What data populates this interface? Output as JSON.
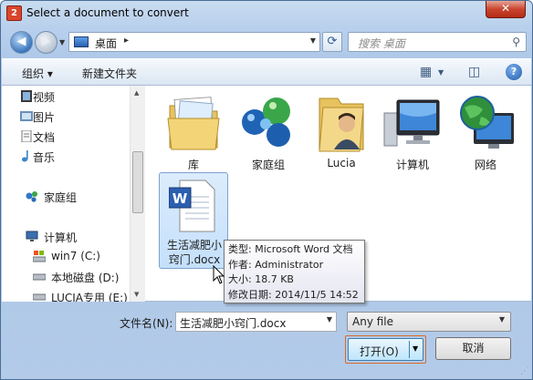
{
  "window": {
    "title": "Select a document to convert",
    "app_icon_text": "2",
    "close_glyph": "✕"
  },
  "nav": {
    "back_glyph": "◀",
    "forward_glyph": "▶"
  },
  "address": {
    "location": "桌面",
    "chevron": "▸"
  },
  "search": {
    "placeholder": "搜索 桌面"
  },
  "toolbar": {
    "organize": "组织 ▾",
    "new_folder": "新建文件夹",
    "help": "?"
  },
  "sidebar": {
    "items": [
      {
        "label": "视频"
      },
      {
        "label": "图片"
      },
      {
        "label": "文档"
      },
      {
        "label": "音乐"
      },
      {
        "label": "家庭组"
      },
      {
        "label": "计算机"
      },
      {
        "label": "win7 (C:)"
      },
      {
        "label": "本地磁盘 (D:)"
      },
      {
        "label": "LUCIA专用 (E:)"
      }
    ]
  },
  "files": [
    {
      "label": "库",
      "icon": "libraries-icon"
    },
    {
      "label": "家庭组",
      "icon": "homegroup-icon"
    },
    {
      "label": "Lucia",
      "icon": "user-folder-icon"
    },
    {
      "label": "计算机",
      "icon": "computer-icon"
    },
    {
      "label": "网络",
      "icon": "network-icon"
    },
    {
      "label_line1": "生活减肥小",
      "label_line2": "窍门.docx",
      "icon": "word-document-icon",
      "selected": true
    }
  ],
  "tooltip": {
    "type": "类型: Microsoft Word 文档",
    "author": "作者: Administrator",
    "size": "大小: 18.7 KB",
    "modified": "修改日期: 2014/11/5 14:52"
  },
  "footer": {
    "filename_label": "文件名(N):",
    "filename_value": "生活减肥小窍门.docx",
    "filter_value": "Any file",
    "open_label": "打开(O)",
    "cancel_label": "取消"
  },
  "colors": {
    "accent": "#3c7fb1",
    "open_border": "#d86a2b",
    "selection": "#c4e0fc",
    "close": "#c9452f"
  }
}
